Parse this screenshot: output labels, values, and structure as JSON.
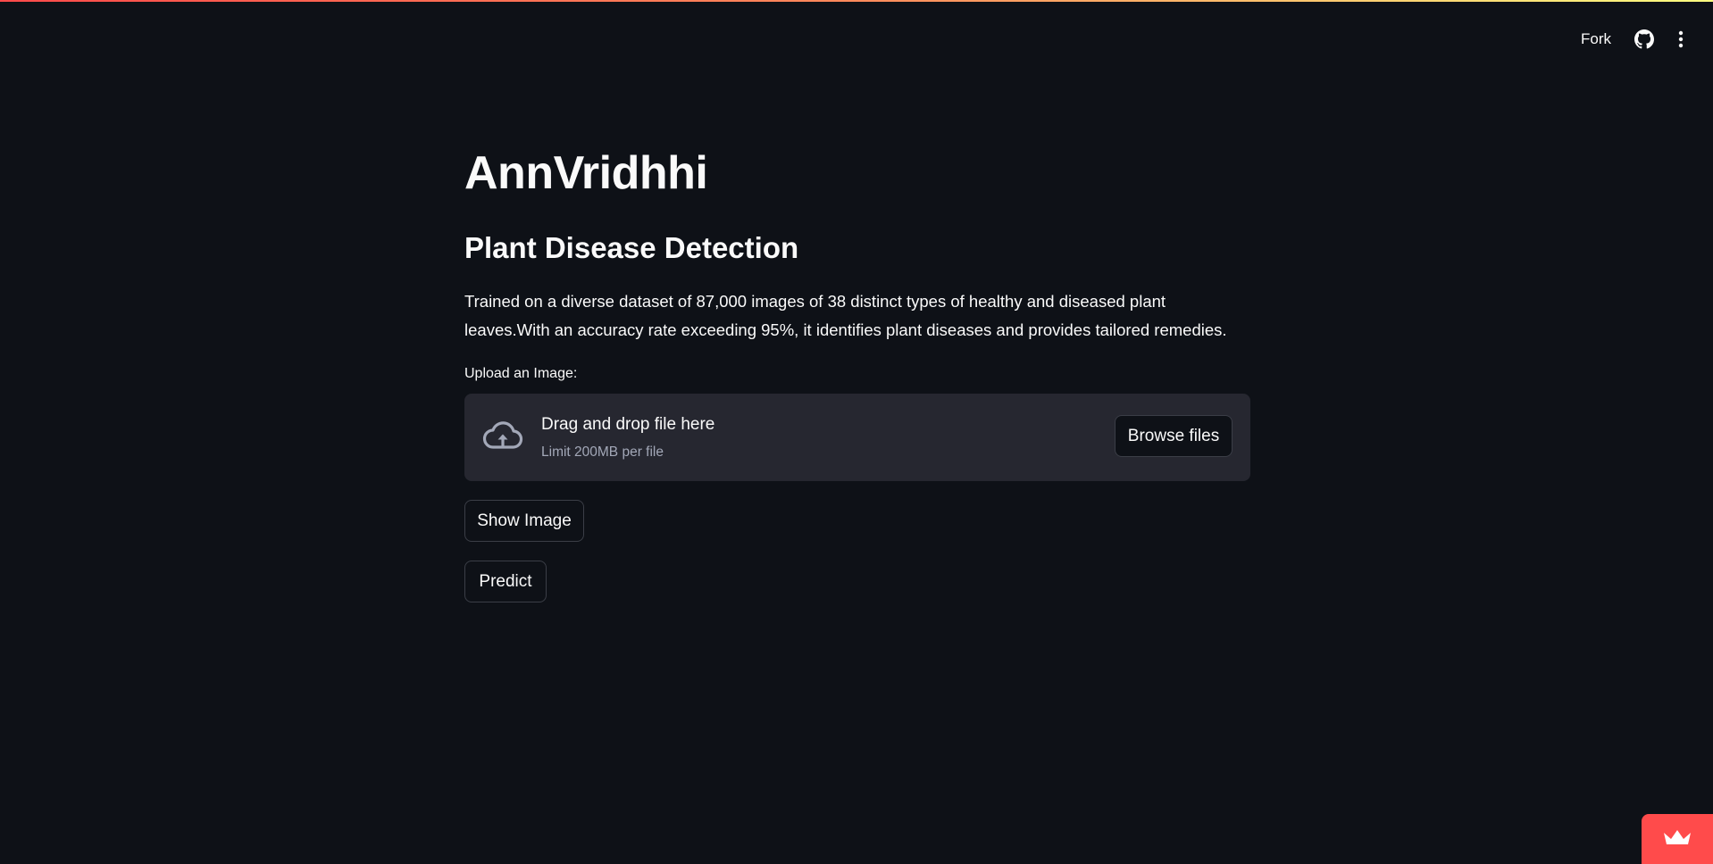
{
  "toolbar": {
    "fork_label": "Fork",
    "github_icon": "github-icon",
    "menu_icon": "kebab-menu-icon"
  },
  "app": {
    "title": "AnnVridhhi",
    "subheader": "Plant Disease Detection",
    "description": "Trained on a diverse dataset of 87,000 images of 38 distinct types of healthy and diseased plant leaves.With an accuracy rate exceeding 95%, it identifies plant diseases and provides tailored remedies."
  },
  "uploader": {
    "label": "Upload an Image:",
    "dropzone_title": "Drag and drop file here",
    "dropzone_limit": "Limit 200MB per file",
    "browse_label": "Browse files",
    "icon": "cloud-upload-icon"
  },
  "buttons": {
    "show_image": "Show Image",
    "predict": "Predict"
  },
  "badge": {
    "icon": "crown-icon"
  },
  "colors": {
    "background": "#0e1117",
    "surface": "#262730",
    "accent": "#ff4b4b",
    "text": "#fafafa",
    "muted_text": "#a3a8b8"
  }
}
